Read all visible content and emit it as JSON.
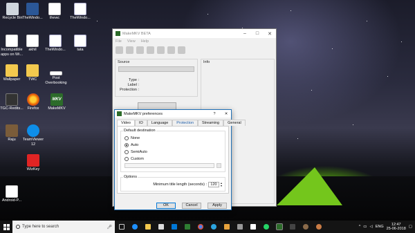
{
  "desktop": {
    "icons": [
      {
        "label": "Recycle Bin"
      },
      {
        "label": "TheWindo..."
      },
      {
        "label": "thewc"
      },
      {
        "label": "TheWindo..."
      },
      {
        "label": "Incompatible apps on Wi..."
      },
      {
        "label": "akhil"
      },
      {
        "label": "TheWindo..."
      },
      {
        "label": "tata"
      },
      {
        "label": "Wallpaper"
      },
      {
        "label": "TWC"
      },
      {
        "label": "Post Overbooking"
      },
      {
        "label": "TGC-Redits..."
      },
      {
        "label": "Firefox"
      },
      {
        "label": "MakeMKV"
      },
      {
        "label": "Raju"
      },
      {
        "label": "TeamViewer 12"
      },
      {
        "label": "WizKey"
      },
      {
        "label": "Android-P..."
      }
    ]
  },
  "main_window": {
    "title": "MakeMKV BETA",
    "menu": [
      "File",
      "View",
      "Help"
    ],
    "source_label": "Source",
    "info_label": "Info",
    "fields": [
      {
        "label": "Type :"
      },
      {
        "label": "Label :"
      },
      {
        "label": "Protection :"
      }
    ]
  },
  "prefs": {
    "title": "MakeMKV preferences",
    "help": "?",
    "close": "✕",
    "tabs": [
      "Video",
      "IO",
      "Language",
      "Protection",
      "Streaming",
      "General"
    ],
    "destination_label": "Default destination",
    "radios": [
      {
        "label": "None",
        "checked": false
      },
      {
        "label": "Auto",
        "checked": true
      },
      {
        "label": "SemiAuto",
        "checked": false
      },
      {
        "label": "Custom",
        "checked": false
      }
    ],
    "options_label": "Options",
    "min_title_label": "Minimum title length (seconds) :",
    "min_title_value": "120",
    "ok": "OK",
    "cancel": "Cancel",
    "apply": "Apply"
  },
  "taskbar": {
    "search_placeholder": "Type here to search",
    "lang": "ENG",
    "time": "12:47",
    "date": "25-06-2018"
  }
}
